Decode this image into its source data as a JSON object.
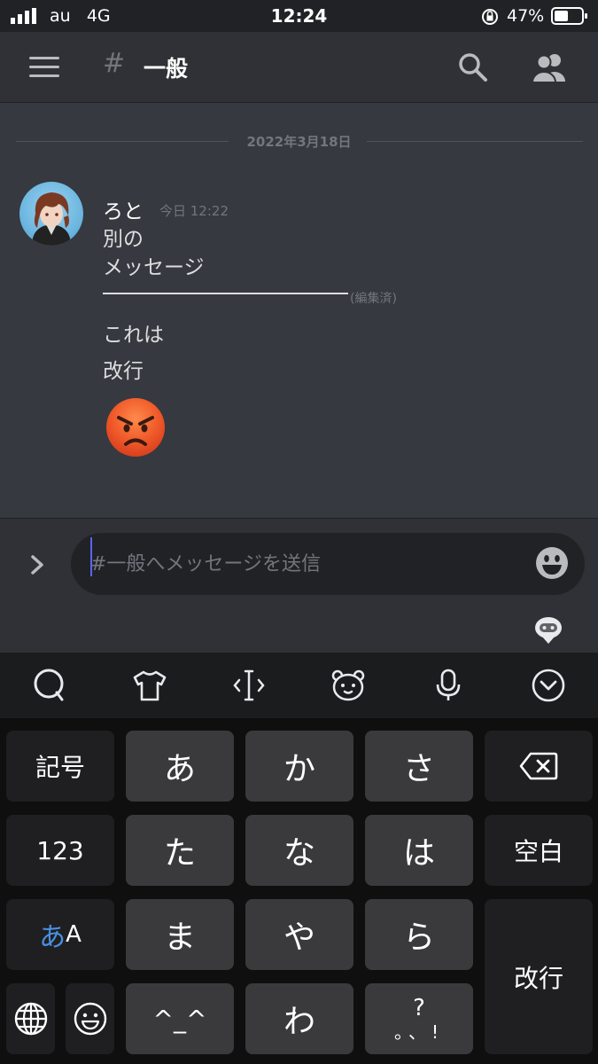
{
  "status_bar": {
    "carrier": "au",
    "network": "4G",
    "time": "12:24",
    "battery": "47%"
  },
  "header": {
    "hash": "#",
    "channel_name": "一般"
  },
  "chat": {
    "date_divider": "2022年3月18日",
    "message": {
      "username": "ろと",
      "timestamp": "今日 12:22",
      "lines": [
        "別の",
        "メッセージ",
        "これは",
        "改行"
      ],
      "edited": "(編集済)"
    }
  },
  "composer": {
    "placeholder": "#一般へメッセージを送信"
  },
  "keyboard": {
    "keys": {
      "kigou": "記号",
      "a": "あ",
      "ka": "か",
      "sa": "さ",
      "num": "123",
      "ta": "た",
      "na": "な",
      "ha": "は",
      "space": "空白",
      "kana": "あ",
      "alpha": "A",
      "ma": "ま",
      "ya": "や",
      "ra": "ら",
      "enter": "改行",
      "kaomoji": "^_^",
      "wa": "わ",
      "punct_top": "?",
      "punct_bottom": "。、!"
    }
  },
  "colors": {
    "background": "#36393f",
    "header": "#2f3136",
    "accent": "#5865f2",
    "keyboard_key": "#3a3a3c",
    "kana_blue": "#4a90e2"
  }
}
